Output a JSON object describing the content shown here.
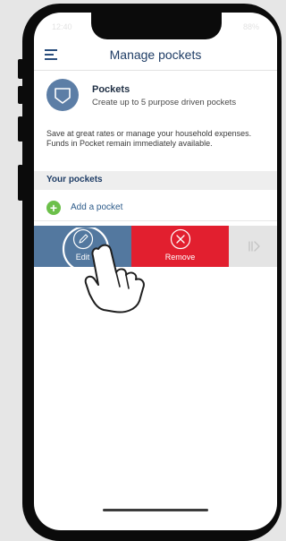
{
  "status": {
    "time": "12:40",
    "indicators": "88%"
  },
  "header": {
    "title": "Manage pockets",
    "menu_icon": "menu-icon"
  },
  "pocket_info": {
    "title": "Pockets",
    "subtitle": "Create up to 5 purpose driven pockets",
    "icon": "shield-icon"
  },
  "description": "Save at great rates or manage your household expenses. Funds in Pocket remain immediately available.",
  "section": {
    "title": "Your pockets"
  },
  "add_pocket": {
    "label": "Add a pocket",
    "icon": "plus-icon"
  },
  "swipe_actions": {
    "edit_label": "Edit",
    "remove_label": "Remove",
    "edit_icon": "pencil-icon",
    "remove_icon": "close-icon",
    "next_icon": "chevron-right-icon"
  },
  "colors": {
    "primary": "#1f3d66",
    "edit_bg": "#53789f",
    "remove_bg": "#e21f2f",
    "add_green": "#6cc04a"
  }
}
